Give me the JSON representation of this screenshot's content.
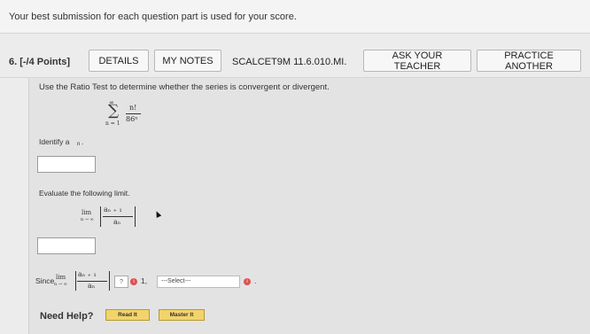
{
  "banner": {
    "text": "Your best submission for each question part is used for your score."
  },
  "question": {
    "number_points": "6.  [-/4 Points]",
    "buttons": {
      "details": "DETAILS",
      "my_notes": "MY NOTES",
      "ask_teacher": "ASK YOUR TEACHER",
      "practice_another": "PRACTICE ANOTHER"
    },
    "code": "SCALCET9M 11.6.010.MI.",
    "instruction": "Use the Ratio Test to determine whether the series is convergent or divergent.",
    "series": {
      "sigma": "∑",
      "upper": "∞",
      "lower": "n = 1",
      "numerator": "n!",
      "denominator": "86ⁿ"
    },
    "identify_label": "Identify a",
    "identify_sub": "n",
    "identify_period": ".",
    "identify_value": "",
    "evaluate_label": "Evaluate the following limit.",
    "limit": {
      "lim": "lim",
      "lim_sub": "n → ∞",
      "num": "aₙ ₊ ₁",
      "den": "aₙ"
    },
    "limit_value": "",
    "since_label": "Since",
    "compare_value": "?",
    "compare_one": "1,",
    "select_placeholder": "---Select---",
    "period": "."
  },
  "help": {
    "label": "Need Help?",
    "read_it": "Read It",
    "master_it": "Master It"
  },
  "colors": {
    "help_button": "#f3d46a",
    "alert_icon": "#d9534f"
  },
  "icons": [
    "info-circle-icon",
    "mouse-cursor-icon"
  ]
}
